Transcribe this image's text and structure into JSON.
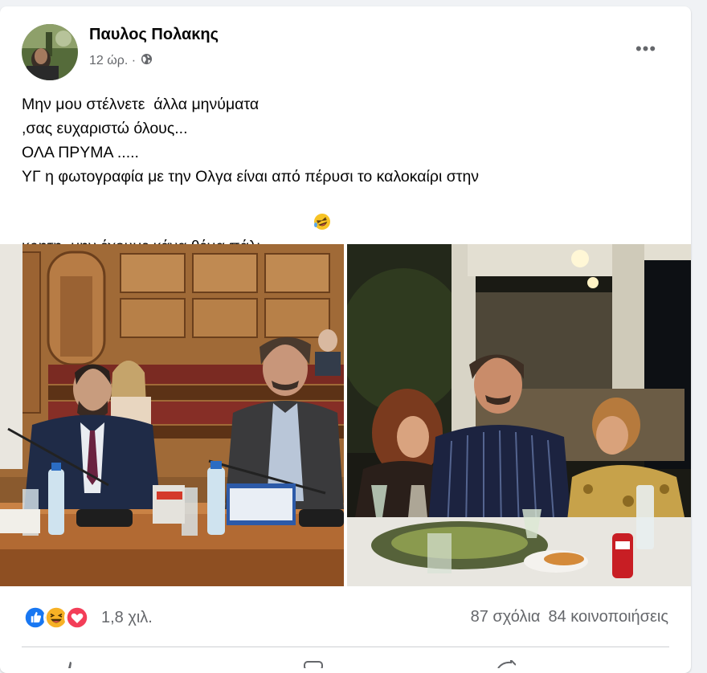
{
  "post": {
    "author": "Παυλος Πολακης",
    "time": "12 ώρ. ·",
    "privacy_icon": "globe-icon",
    "more_label": "•••",
    "text_lines": [
      "Μην μου στέλνετε  άλλα μηνύματα",
      ",σας ευχαριστώ όλους...",
      "ΟΛΑ ΠΡΥΜΑ .....",
      "ΥΓ η φωτογραφία με την Ολγα είναι από πέρυσι το καλοκαίρι στην",
      "κρητη ,μην έχουμε κάνα θέμα πάλι...."
    ],
    "text_emoji_icon": "rofl-emoji-icon"
  },
  "photos": [
    {
      "subject": "parliament-session-photo"
    },
    {
      "subject": "taverna-dinner-photo"
    }
  ],
  "engagement": {
    "reaction_icons": [
      "like-icon",
      "haha-icon",
      "love-icon"
    ],
    "reactions_count": "1,8 χιλ.",
    "comments": "87 σχόλια",
    "shares": "84 κοινοποιήσεις"
  },
  "colors": {
    "like_blue": "#1877f2",
    "love_red": "#f33e58",
    "haha_yellow": "#f7b125",
    "secondary_text": "#65676b"
  }
}
